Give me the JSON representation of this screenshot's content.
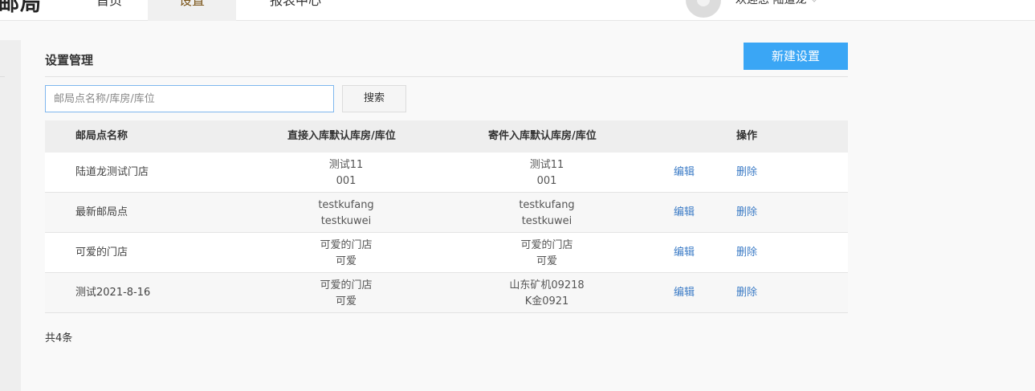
{
  "header": {
    "brand": "邮局",
    "nav": [
      {
        "label": "首页"
      },
      {
        "label": "设置"
      },
      {
        "label": "报表中心"
      }
    ],
    "welcome": "欢迎您  陆道龙"
  },
  "main": {
    "title": "设置管理",
    "new_button": "新建设置",
    "search": {
      "placeholder": "邮局点名称/库房/库位",
      "value": "",
      "button": "搜索"
    },
    "table": {
      "columns": {
        "name": "邮局点名称",
        "direct": "直接入库默认库房/库位",
        "mail": "寄件入库默认库房/库位",
        "actions": "操作"
      },
      "rows": [
        {
          "name": "陆道龙测试门店",
          "direct_warehouse": "测试11",
          "direct_location": "001",
          "mail_warehouse": "测试11",
          "mail_location": "001",
          "edit": "编辑",
          "delete": "删除"
        },
        {
          "name": "最新邮局点",
          "direct_warehouse": "testkufang",
          "direct_location": "testkuwei",
          "mail_warehouse": "testkufang",
          "mail_location": "testkuwei",
          "edit": "编辑",
          "delete": "删除"
        },
        {
          "name": "可爱的门店",
          "direct_warehouse": "可爱的门店",
          "direct_location": "可爱",
          "mail_warehouse": "可爱的门店",
          "mail_location": "可爱",
          "edit": "编辑",
          "delete": "删除"
        },
        {
          "name": "测试2021-8-16",
          "direct_warehouse": "可爱的门店",
          "direct_location": "可爱",
          "mail_warehouse": "山东矿机09218",
          "mail_location": "K金0921",
          "edit": "编辑",
          "delete": "删除"
        }
      ]
    },
    "total": "共4条"
  }
}
